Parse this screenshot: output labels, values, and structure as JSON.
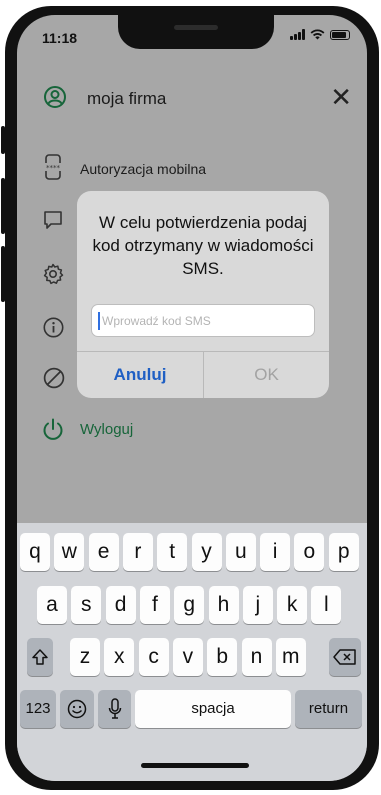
{
  "status_bar": {
    "time": "11:18"
  },
  "header": {
    "title": "moja firma"
  },
  "menu": {
    "mobile_auth_label": "Autoryzacja mobilna",
    "logout_label": "Wyloguj"
  },
  "dialog": {
    "title": "W celu potwierdzenia podaj kod otrzymany w wiadomości SMS.",
    "input_value": "",
    "input_placeholder": "Wprowadź kod SMS",
    "cancel_label": "Anuluj",
    "ok_label": "OK"
  },
  "keyboard": {
    "row1": [
      "q",
      "w",
      "e",
      "r",
      "t",
      "y",
      "u",
      "i",
      "o",
      "p"
    ],
    "row2": [
      "a",
      "s",
      "d",
      "f",
      "g",
      "h",
      "j",
      "k",
      "l"
    ],
    "row3": [
      "z",
      "x",
      "c",
      "v",
      "b",
      "n",
      "m"
    ],
    "numbers_label": "123",
    "space_label": "spacja",
    "return_label": "return"
  },
  "colors": {
    "accent_green": "#17653a",
    "link_blue": "#1f5fc4"
  }
}
